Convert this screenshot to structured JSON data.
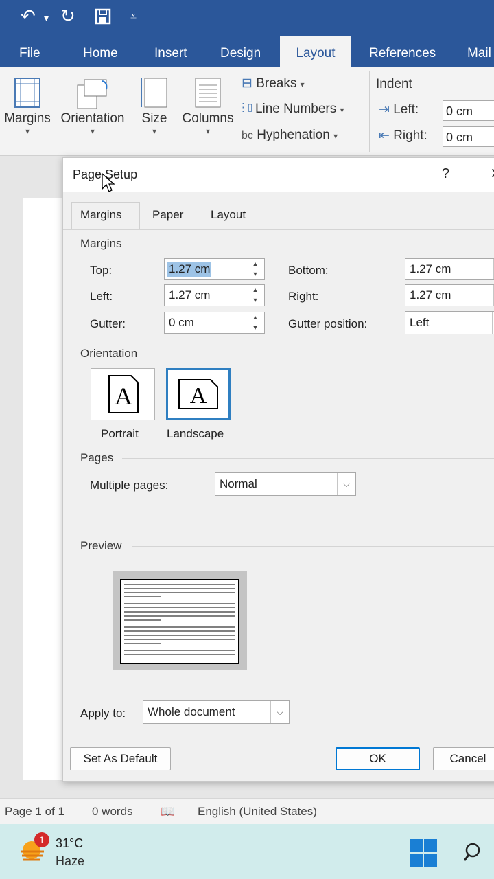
{
  "tabs": [
    "File",
    "Home",
    "Insert",
    "Design",
    "Layout",
    "References",
    "Mail"
  ],
  "ribbon": {
    "margins": "Margins",
    "orientation": "Orientation",
    "size": "Size",
    "columns": "Columns",
    "breaks": "Breaks",
    "line_numbers": "Line Numbers",
    "hyphenation": "Hyphenation",
    "indent": "Indent",
    "left": "Left:",
    "right": "Right:",
    "left_val": "0 cm",
    "right_val": "0 cm"
  },
  "dialog": {
    "title": "Page Setup",
    "help": "?",
    "tabs": [
      "Margins",
      "Paper",
      "Layout"
    ],
    "margins_group": "Margins",
    "top_label": "Top:",
    "top_value": "1.27 cm",
    "left_label": "Left:",
    "left_value": "1.27 cm",
    "gutter_label": "Gutter:",
    "gutter_value": "0 cm",
    "bottom_label": "Bottom:",
    "bottom_value": "1.27 cm",
    "right_label": "Right:",
    "right_value": "1.27 cm",
    "gutter_pos_label": "Gutter position:",
    "gutter_pos_value": "Left",
    "orientation_group": "Orientation",
    "portrait": "Portrait",
    "landscape": "Landscape",
    "pages_group": "Pages",
    "multiple_pages_label": "Multiple pages:",
    "multiple_pages_value": "Normal",
    "preview_group": "Preview",
    "apply_to_label": "Apply to:",
    "apply_to_value": "Whole document",
    "set_default": "Set As Default",
    "ok": "OK",
    "cancel": "Cancel"
  },
  "status": {
    "page": "Page 1 of 1",
    "words": "0 words",
    "language": "English (United States)"
  },
  "taskbar": {
    "temp": "31°C",
    "weather": "Haze",
    "badge": "1"
  },
  "colors": {
    "accent": "#2b579a",
    "focus": "#0078d4",
    "taskbar": "#d1ecec"
  }
}
